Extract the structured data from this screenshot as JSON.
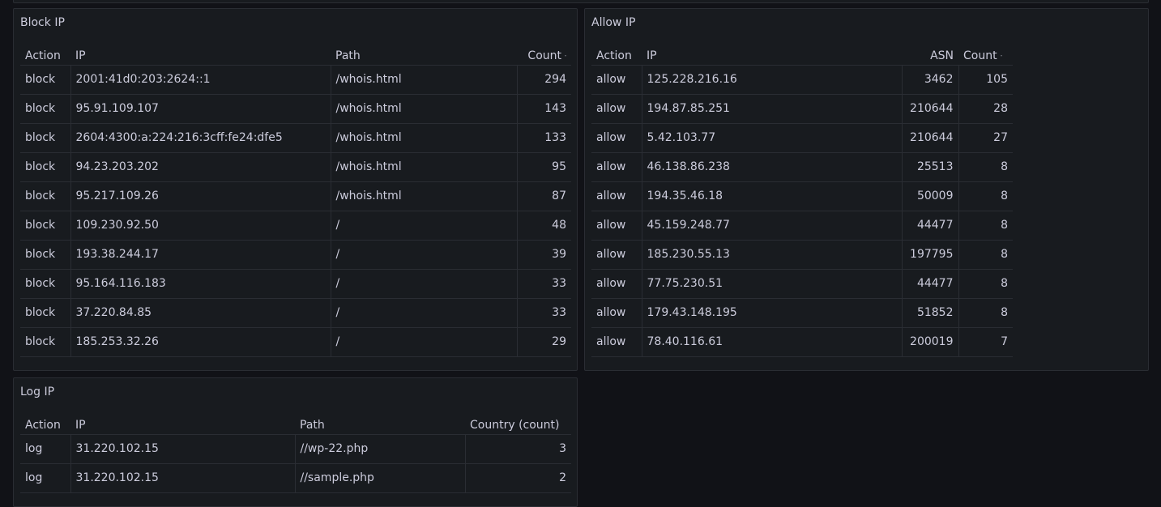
{
  "block_panel": {
    "title": "Block IP",
    "columns": [
      "Action",
      "IP",
      "Path",
      "Count"
    ],
    "rows": [
      {
        "action": "block",
        "ip": "2001:41d0:203:2624::1",
        "path": "/whois.html",
        "count": "294"
      },
      {
        "action": "block",
        "ip": "95.91.109.107",
        "path": "/whois.html",
        "count": "143"
      },
      {
        "action": "block",
        "ip": "2604:4300:a:224:216:3cff:fe24:dfe5",
        "path": "/whois.html",
        "count": "133"
      },
      {
        "action": "block",
        "ip": "94.23.203.202",
        "path": "/whois.html",
        "count": "95"
      },
      {
        "action": "block",
        "ip": "95.217.109.26",
        "path": "/whois.html",
        "count": "87"
      },
      {
        "action": "block",
        "ip": "109.230.92.50",
        "path": "/",
        "count": "48"
      },
      {
        "action": "block",
        "ip": "193.38.244.17",
        "path": "/",
        "count": "39"
      },
      {
        "action": "block",
        "ip": "95.164.116.183",
        "path": "/",
        "count": "33"
      },
      {
        "action": "block",
        "ip": "37.220.84.85",
        "path": "/",
        "count": "33"
      },
      {
        "action": "block",
        "ip": "185.253.32.26",
        "path": "/",
        "count": "29"
      }
    ]
  },
  "allow_panel": {
    "title": "Allow IP",
    "columns": [
      "Action",
      "IP",
      "ASN",
      "Count"
    ],
    "rows": [
      {
        "action": "allow",
        "ip": "125.228.216.16",
        "asn": "3462",
        "count": "105"
      },
      {
        "action": "allow",
        "ip": "194.87.85.251",
        "asn": "210644",
        "count": "28"
      },
      {
        "action": "allow",
        "ip": "5.42.103.77",
        "asn": "210644",
        "count": "27"
      },
      {
        "action": "allow",
        "ip": "46.138.86.238",
        "asn": "25513",
        "count": "8"
      },
      {
        "action": "allow",
        "ip": "194.35.46.18",
        "asn": "50009",
        "count": "8"
      },
      {
        "action": "allow",
        "ip": "45.159.248.77",
        "asn": "44477",
        "count": "8"
      },
      {
        "action": "allow",
        "ip": "185.230.55.13",
        "asn": "197795",
        "count": "8"
      },
      {
        "action": "allow",
        "ip": "77.75.230.51",
        "asn": "44477",
        "count": "8"
      },
      {
        "action": "allow",
        "ip": "179.43.148.195",
        "asn": "51852",
        "count": "8"
      },
      {
        "action": "allow",
        "ip": "78.40.116.61",
        "asn": "200019",
        "count": "7"
      }
    ]
  },
  "log_panel": {
    "title": "Log IP",
    "columns": [
      "Action",
      "IP",
      "Path",
      "Country (count)"
    ],
    "rows": [
      {
        "action": "log",
        "ip": "31.220.102.15",
        "path": "//wp-22.php",
        "count": "3"
      },
      {
        "action": "log",
        "ip": "31.220.102.15",
        "path": "//sample.php",
        "count": "2"
      }
    ]
  },
  "colors": {
    "background": "#111217",
    "panel": "#181b1f",
    "border": "#2a2d33",
    "text": "#ccccdc"
  }
}
